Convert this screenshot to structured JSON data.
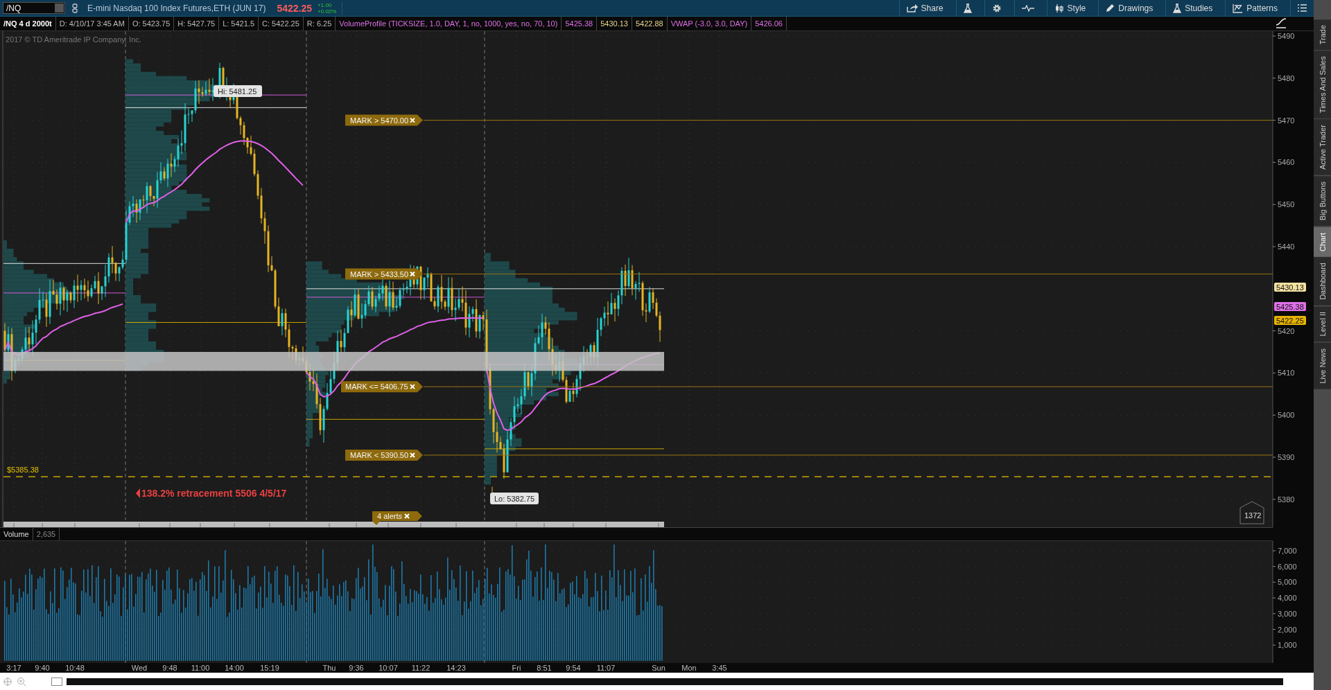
{
  "toolbar": {
    "symbol": "/NQ",
    "description": "E-mini Nasdaq 100 Index Futures,ETH (JUN 17)",
    "last_price": "5422.25",
    "net_change": "+1.00",
    "percent_change": "+0.02%",
    "buttons": [
      {
        "kind": "share",
        "label": "Share"
      },
      {
        "kind": "beaker"
      },
      {
        "kind": "gear"
      },
      {
        "kind": "wave"
      },
      {
        "kind": "style",
        "label": "Style"
      },
      {
        "kind": "drawings",
        "label": "Drawings"
      },
      {
        "kind": "studies",
        "label": "Studies"
      },
      {
        "kind": "patterns",
        "label": "Patterns"
      },
      {
        "kind": "menu"
      }
    ]
  },
  "info_bar": {
    "title": "/NQ 4 d 2000t",
    "fields": [
      {
        "text": "D: 4/10/17 3:45 AM",
        "kind": "plain"
      },
      {
        "text": "O: 5423.75",
        "kind": "plain"
      },
      {
        "text": "H: 5427.75",
        "kind": "plain"
      },
      {
        "text": "L: 5421.5",
        "kind": "plain"
      },
      {
        "text": "C: 5422.25",
        "kind": "plain"
      },
      {
        "text": "R: 6.25",
        "kind": "plain"
      },
      {
        "text": "VolumeProfile (TICKSIZE, 1.0, DAY, 1, no, 1000, yes, no, 70, 10)",
        "kind": "study"
      },
      {
        "text": "5425.38",
        "kind": "study"
      },
      {
        "text": "5430.13",
        "kind": "level"
      },
      {
        "text": "5422.88",
        "kind": "level"
      },
      {
        "text": "VWAP (-3.0, 3.0, DAY)",
        "kind": "study"
      },
      {
        "text": "5426.06",
        "kind": "study"
      }
    ]
  },
  "chart": {
    "copyright": "2017 © TD Ameritrade IP Company, Inc.",
    "price_ticks": [
      "5490",
      "5480",
      "5470",
      "5460",
      "5450",
      "5440",
      "5420",
      "5410",
      "5400",
      "5390",
      "5380"
    ],
    "high_label": "Hi: 5481.25",
    "low_label": "Lo: 5382.75",
    "alerts": [
      {
        "text": "MARK > 5470.00"
      },
      {
        "text": "MARK > 5433.50"
      },
      {
        "text": "MARK <= 5406.75"
      },
      {
        "text": "MARK < 5390.50"
      }
    ],
    "price_labels": [
      {
        "text": "5430.13",
        "color": "#f3e2a0"
      },
      {
        "text": "5425.38",
        "color": "#e070e8"
      },
      {
        "text": "5422.25",
        "color": "#e8b400"
      }
    ],
    "stop_label": "$5385.38",
    "note": "138.2% retracement 5506 4/5/17",
    "alerts_badge": "4 alerts",
    "bubble": "1372"
  },
  "volume": {
    "label": "Volume",
    "value": "2,635",
    "ticks": [
      "7,000",
      "6,000",
      "5,000",
      "4,000",
      "3,000",
      "2,000",
      "1,000"
    ]
  },
  "time_axis": [
    "3:17",
    "9:40",
    "10:48",
    "Wed",
    "9:48",
    "11:00",
    "14:00",
    "15:19",
    "Thu",
    "9:36",
    "10:07",
    "11:22",
    "14:23",
    "Fri",
    "8:51",
    "9:54",
    "11:07",
    "Sun",
    "Mon",
    "3:45"
  ],
  "side_tabs": [
    {
      "label": "Trade",
      "selected": false
    },
    {
      "label": "Times And Sales",
      "selected": false
    },
    {
      "label": "Active Trader",
      "selected": false
    },
    {
      "label": "Big Buttons",
      "selected": false
    },
    {
      "label": "Chart",
      "selected": true
    },
    {
      "label": "Dashboard",
      "selected": false
    },
    {
      "label": "Level II",
      "selected": false
    },
    {
      "label": "Live News",
      "selected": false
    }
  ]
}
